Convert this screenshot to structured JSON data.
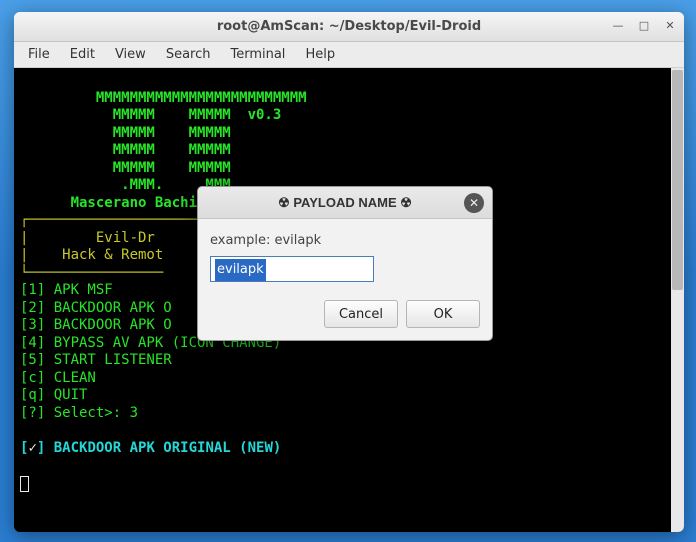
{
  "window": {
    "title": "root@AmScan: ~/Desktop/Evil-Droid"
  },
  "menubar": {
    "file": "File",
    "edit": "Edit",
    "view": "View",
    "search": "Search",
    "terminal": "Terminal",
    "help": "Help"
  },
  "terminal": {
    "banner_row1": "         MMMMMMMMMMMMMMMMMMMMMMMMM",
    "banner_row2": "           MMMMM    MMMMM  v0.3",
    "banner_row3": "           MMMMM    MMMMM",
    "banner_row4": "           MMMMM    MMMMM",
    "banner_row5": "           MMMMM    MMMMM",
    "banner_row6": "            .MMM.    .MMM.",
    "author": "      Mascerano Bachir - Dev-labs",
    "boxtop": "┌───────────────────────────────────────┐",
    "boxline1": "|        Evil-Dr",
    "boxline2": "|    Hack & Remot",
    "boxbottom": "└────────────────",
    "opt1": "[1] APK MSF",
    "opt2": "[2] BACKDOOR APK O",
    "opt3": "[3] BACKDOOR APK O",
    "opt4": "[4] BYPASS AV APK (ICON CHANGE)",
    "opt5": "[5] START LISTENER",
    "optc": "[c] CLEAN",
    "optq": "[q] QUIT",
    "prompt": "[?] Select>: 3",
    "status_prefix": "[",
    "status_check": "✓",
    "status_suffix": "] ",
    "status_text": "BACKDOOR APK ORIGINAL (NEW)"
  },
  "dialog": {
    "title": "☢ PAYLOAD NAME ☢",
    "example": "example: evilapk",
    "input_value": "evilapk",
    "cancel": "Cancel",
    "ok": "OK"
  },
  "icons": {
    "minimize": "—",
    "maximize": "□",
    "close": "✕"
  }
}
